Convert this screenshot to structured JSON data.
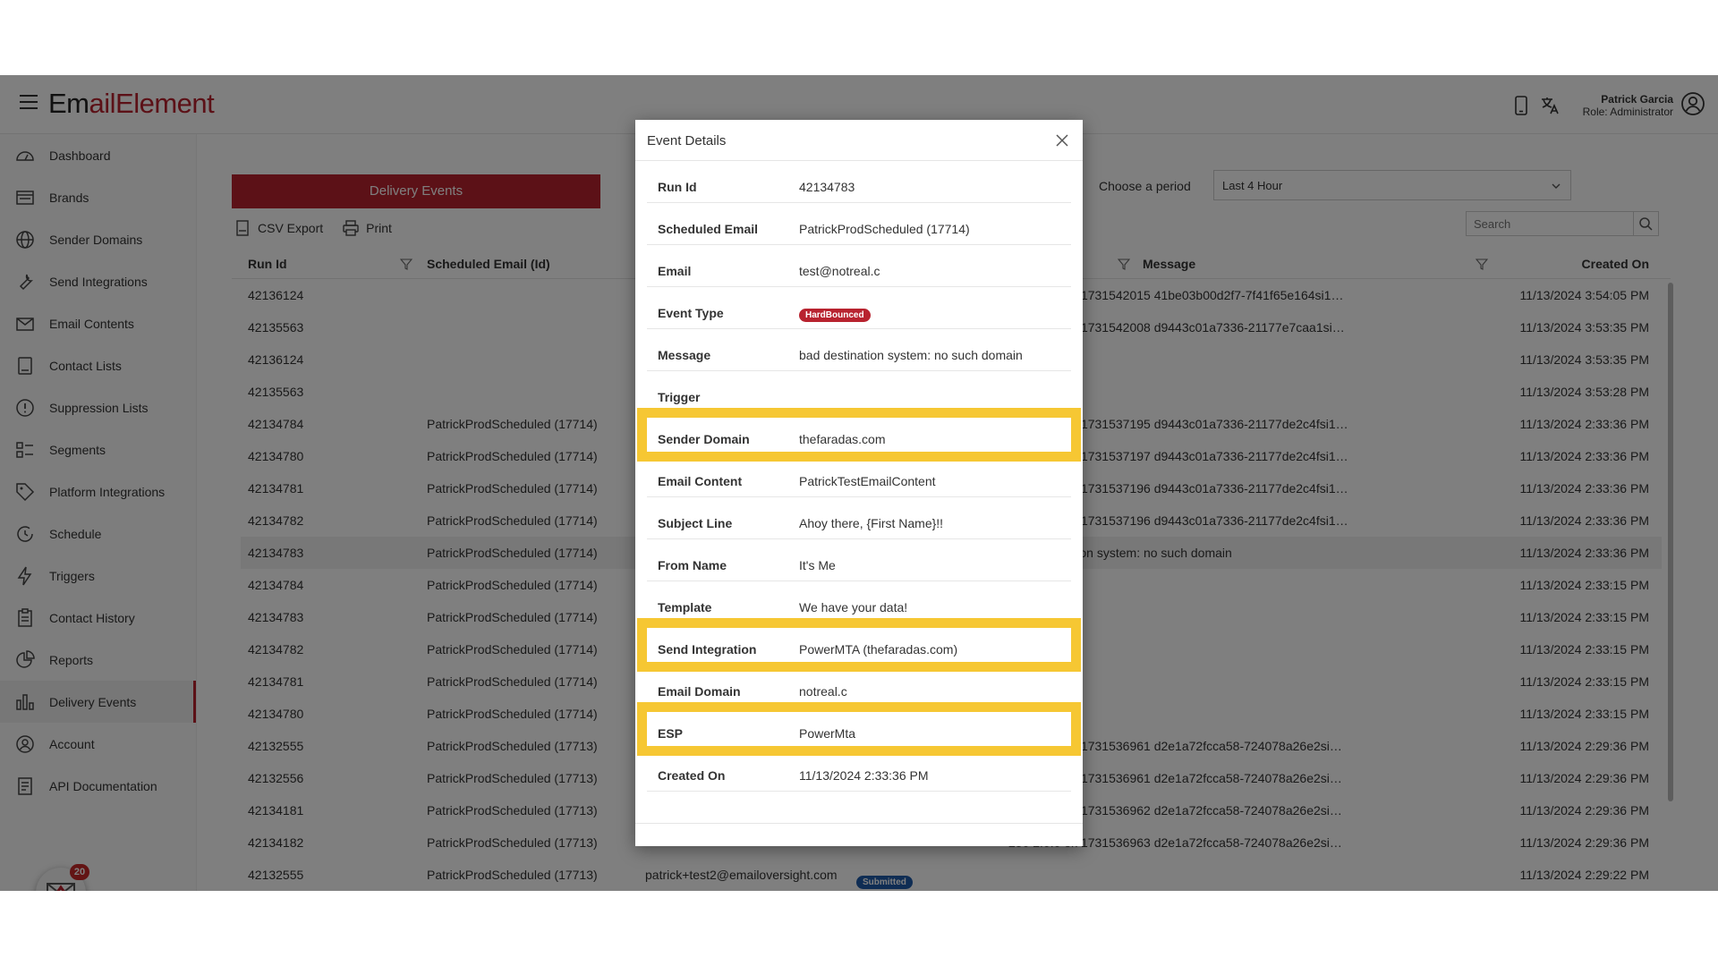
{
  "header": {
    "logo_part1": "Em",
    "logo_part2": "ail",
    "logo_part3": "Element",
    "user_name": "Patrick Garcia",
    "user_role": "Role: Administrator"
  },
  "sidebar": {
    "items": [
      {
        "label": "Dashboard",
        "icon": "dashboard-icon"
      },
      {
        "label": "Brands",
        "icon": "brands-icon"
      },
      {
        "label": "Sender Domains",
        "icon": "globe-icon"
      },
      {
        "label": "Send Integrations",
        "icon": "wrench-icon"
      },
      {
        "label": "Email Contents",
        "icon": "envelope-icon"
      },
      {
        "label": "Contact Lists",
        "icon": "contact-list-icon"
      },
      {
        "label": "Suppression Lists",
        "icon": "alert-icon"
      },
      {
        "label": "Segments",
        "icon": "segments-icon"
      },
      {
        "label": "Platform Integrations",
        "icon": "tag-icon"
      },
      {
        "label": "Schedule",
        "icon": "schedule-icon"
      },
      {
        "label": "Triggers",
        "icon": "bolt-icon"
      },
      {
        "label": "Contact History",
        "icon": "clipboard-icon"
      },
      {
        "label": "Reports",
        "icon": "pie-chart-icon"
      },
      {
        "label": "Delivery Events",
        "icon": "bar-chart-icon"
      },
      {
        "label": "Account",
        "icon": "user-icon"
      },
      {
        "label": "API Documentation",
        "icon": "document-icon"
      }
    ],
    "active": "Delivery Events",
    "chat_count": "20"
  },
  "main": {
    "panel_title": "Delivery Events",
    "csv_export": "CSV Export",
    "print": "Print",
    "period_label": "Choose a period",
    "period_value": "Last 4 Hour",
    "search_placeholder": "Search",
    "columns": {
      "run_id": "Run Id",
      "scheduled_email": "Scheduled Email (Id)",
      "message": "Message",
      "created_on": "Created On"
    },
    "rows": [
      {
        "run": "42136124",
        "sched": "",
        "email": "",
        "status": "",
        "msg": "250 2.0.0 ok 1731542015 41be03b00d2f7-7f41f65e164si182...",
        "created": "11/13/2024 3:54:05 PM"
      },
      {
        "run": "42135563",
        "sched": "",
        "email": "",
        "status": "",
        "msg": "250 2.0.0 ok 1731542008 d9443c01a7336-21177e7caa1si19...",
        "created": "11/13/2024 3:53:35 PM"
      },
      {
        "run": "42136124",
        "sched": "",
        "email": "",
        "status": "",
        "msg": "",
        "created": "11/13/2024 3:53:35 PM"
      },
      {
        "run": "42135563",
        "sched": "",
        "email": "",
        "status": "",
        "msg": "",
        "created": "11/13/2024 3:53:28 PM"
      },
      {
        "run": "42134784",
        "sched": "PatrickProdScheduled (17714)",
        "email": "",
        "status": "",
        "msg": "250 2.0.0 ok 1731537195 d9443c01a7336-21177de2c4fsi178...",
        "created": "11/13/2024 2:33:36 PM"
      },
      {
        "run": "42134780",
        "sched": "PatrickProdScheduled (17714)",
        "email": "",
        "status": "",
        "msg": "250 2.0.0 ok 1731537197 d9443c01a7336-21177de2c4fsi178...",
        "created": "11/13/2024 2:33:36 PM"
      },
      {
        "run": "42134781",
        "sched": "PatrickProdScheduled (17714)",
        "email": "",
        "status": "",
        "msg": "250 2.0.0 ok 1731537196 d9443c01a7336-21177de2c4fsi178...",
        "created": "11/13/2024 2:33:36 PM"
      },
      {
        "run": "42134782",
        "sched": "PatrickProdScheduled (17714)",
        "email": "",
        "status": "",
        "msg": "250 2.0.0 ok 1731537196 d9443c01a7336-21177de2c4fsi178...",
        "created": "11/13/2024 2:33:36 PM"
      },
      {
        "run": "42134783",
        "sched": "PatrickProdScheduled (17714)",
        "email": "",
        "status": "",
        "msg": "bad destination system: no such domain",
        "created": "11/13/2024 2:33:36 PM"
      },
      {
        "run": "42134784",
        "sched": "PatrickProdScheduled (17714)",
        "email": "",
        "status": "",
        "msg": "",
        "created": "11/13/2024 2:33:15 PM"
      },
      {
        "run": "42134783",
        "sched": "PatrickProdScheduled (17714)",
        "email": "",
        "status": "",
        "msg": "",
        "created": "11/13/2024 2:33:15 PM"
      },
      {
        "run": "42134782",
        "sched": "PatrickProdScheduled (17714)",
        "email": "",
        "status": "",
        "msg": "",
        "created": "11/13/2024 2:33:15 PM"
      },
      {
        "run": "42134781",
        "sched": "PatrickProdScheduled (17714)",
        "email": "",
        "status": "",
        "msg": "",
        "created": "11/13/2024 2:33:15 PM"
      },
      {
        "run": "42134780",
        "sched": "PatrickProdScheduled (17714)",
        "email": "",
        "status": "",
        "msg": "",
        "created": "11/13/2024 2:33:15 PM"
      },
      {
        "run": "42132555",
        "sched": "PatrickProdScheduled (17713)",
        "email": "",
        "status": "",
        "msg": "250 2.0.0 ok 1731536961 d2e1a72fcca58-724078a26e2si192...",
        "created": "11/13/2024 2:29:36 PM"
      },
      {
        "run": "42132556",
        "sched": "PatrickProdScheduled (17713)",
        "email": "",
        "status": "",
        "msg": "250 2.0.0 ok 1731536961 d2e1a72fcca58-724078a26e2si192...",
        "created": "11/13/2024 2:29:36 PM"
      },
      {
        "run": "42134181",
        "sched": "PatrickProdScheduled (17713)",
        "email": "",
        "status": "",
        "msg": "250 2.0.0 ok 1731536962 d2e1a72fcca58-724078a26e2si192...",
        "created": "11/13/2024 2:29:36 PM"
      },
      {
        "run": "42134182",
        "sched": "PatrickProdScheduled (17713)",
        "email": "",
        "status": "",
        "msg": "250 2.0.0 ok 1731536963 d2e1a72fcca58-724078a26e2si192...",
        "created": "11/13/2024 2:29:36 PM"
      },
      {
        "run": "42132555",
        "sched": "PatrickProdScheduled (17713)",
        "email": "patrick+test2@emailoversight.com",
        "status": "Submitted",
        "msg": "",
        "created": "11/13/2024 2:29:22 PM"
      }
    ],
    "selected_row": 8
  },
  "modal": {
    "title": "Event Details",
    "fields": [
      {
        "label": "Run Id",
        "value": "42134783",
        "highlight": false
      },
      {
        "label": "Scheduled Email",
        "value": "PatrickProdScheduled (17714)",
        "highlight": false
      },
      {
        "label": "Email",
        "value": "test@notreal.c",
        "highlight": false
      },
      {
        "label": "Event Type",
        "value": "HardBounced",
        "highlight": false,
        "badge": true
      },
      {
        "label": "Message",
        "value": "bad destination system: no such domain",
        "highlight": false
      },
      {
        "label": "Trigger",
        "value": "",
        "highlight": false
      },
      {
        "label": "Sender Domain",
        "value": "thefaradas.com",
        "highlight": true
      },
      {
        "label": "Email Content",
        "value": "PatrickTestEmailContent",
        "highlight": false
      },
      {
        "label": "Subject Line",
        "value": "Ahoy there, {First Name}!!",
        "highlight": false
      },
      {
        "label": "From Name",
        "value": "It's Me",
        "highlight": false
      },
      {
        "label": "Template",
        "value": "We have your data!",
        "highlight": false
      },
      {
        "label": "Send Integration",
        "value": "PowerMTA (thefaradas.com)",
        "highlight": true
      },
      {
        "label": "Email Domain",
        "value": "notreal.c",
        "highlight": false
      },
      {
        "label": "ESP",
        "value": "PowerMta",
        "highlight": true
      },
      {
        "label": "Created On",
        "value": "11/13/2024 2:33:36 PM",
        "highlight": false
      }
    ]
  },
  "colors": {
    "brand": "#b8232f",
    "highlight": "#f6c733",
    "submitted": "#1e5aa8"
  }
}
